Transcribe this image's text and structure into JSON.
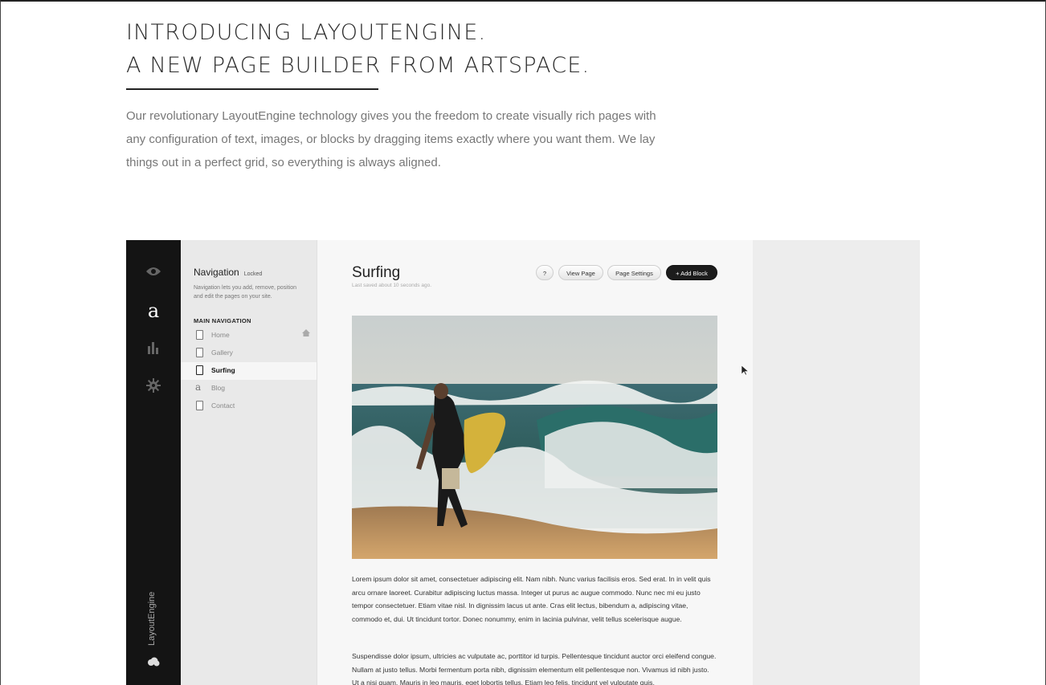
{
  "hero": {
    "title_line1": "INTRODUCING LAYOUTENGINE.",
    "title_line2": "A NEW PAGE BUILDER FROM ARTSPACE.",
    "paragraph": "Our revolutionary LayoutEngine technology gives you the freedom to create visually rich pages with any configuration of text, images, or blocks by dragging items exactly where you want them. We lay things out in a perfect grid, so everything is always aligned."
  },
  "app": {
    "rail": {
      "icons": [
        "eye-icon",
        "artspace-logo-icon",
        "bar-chart-icon",
        "gear-icon",
        "cloud-icon"
      ],
      "logo_glyph": "a",
      "brand_label": "LayoutEngine"
    },
    "navigation": {
      "title": "Navigation",
      "locked_label": "Locked",
      "description": "Navigation lets you add, remove, position and edit the pages on your site.",
      "section_label": "MAIN NAVIGATION",
      "items": [
        {
          "label": "Home",
          "icon": "page-icon"
        },
        {
          "label": "Gallery",
          "icon": "page-icon"
        },
        {
          "label": "Surfing",
          "icon": "page-icon",
          "active": true
        },
        {
          "label": "Blog",
          "icon": "blog-icon"
        },
        {
          "label": "Contact",
          "icon": "page-icon"
        }
      ],
      "blog_glyph": "a"
    },
    "editor": {
      "page_title": "Surfing",
      "saved_status": "Last saved about 10 seconds ago.",
      "help_label": "?",
      "view_page_label": "View Page",
      "page_settings_label": "Page Settings",
      "add_block_label": "+ Add Block",
      "body_paragraph_1": "Lorem ipsum dolor sit amet, consectetuer adipiscing elit. Nam nibh. Nunc varius facilisis eros. Sed erat. In in velit quis arcu ornare laoreet. Curabitur adipiscing luctus massa. Integer ut purus ac augue commodo. Nunc nec mi eu justo tempor consectetuer. Etiam vitae nisl. In dignissim lacus ut ante. Cras elit lectus, bibendum a, adipiscing vitae, commodo et, dui. Ut tincidunt tortor. Donec nonummy, enim in lacinia pulvinar, velit tellus scelerisque augue.",
      "body_paragraph_2": "Suspendisse dolor ipsum, ultricies ac vulputate ac, porttitor id turpis. Pellentesque tincidunt auctor orci eleifend congue. Nullam at justo tellus. Morbi fermentum porta nibh, dignissim elementum elit pellentesque non. Vivamus id nibh justo. Ut a nisi quam. Mauris in leo mauris, eget lobortis tellus. Etiam leo felis, tincidunt vel vulputate quis."
    }
  }
}
